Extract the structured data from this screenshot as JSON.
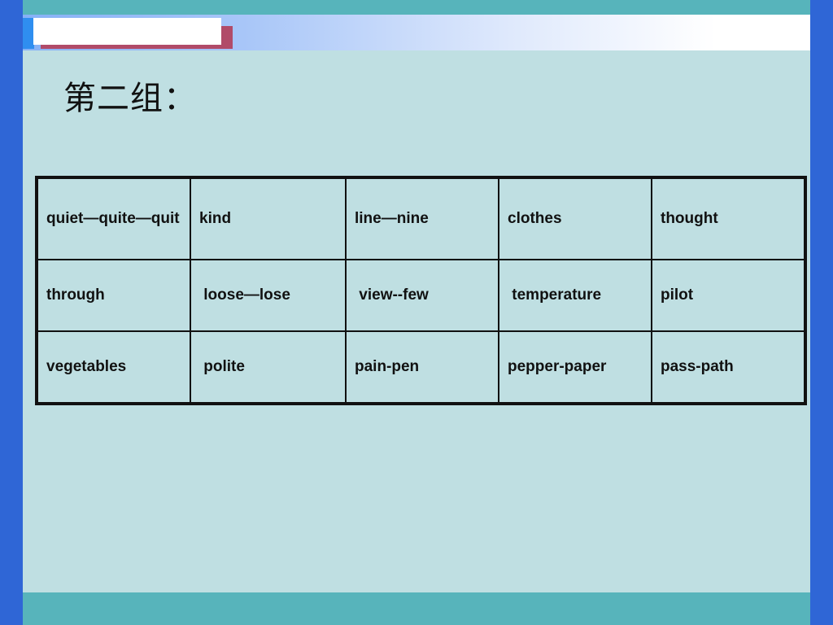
{
  "slide": {
    "title": "第二组：",
    "background_color": "#bfdfe2",
    "frame_color": "#2f66d6",
    "band_color": "#57b4bb",
    "accent_shadow_color": "#b14b69"
  },
  "header": {
    "teal_band": "",
    "gradient_band": "",
    "white_box": "",
    "shadow_box": ""
  },
  "word_table": {
    "rows": [
      {
        "cells": [
          "quiet—quite—quit",
          "kind",
          "line—nine",
          "clothes",
          "thought"
        ]
      },
      {
        "cells": [
          "through",
          " loose—lose",
          " view--few",
          " temperature",
          "pilot"
        ]
      },
      {
        "cells": [
          "vegetables",
          " polite",
          "pain-pen",
          "pepper-paper",
          "pass-path"
        ]
      }
    ]
  },
  "footer": {
    "band": ""
  }
}
